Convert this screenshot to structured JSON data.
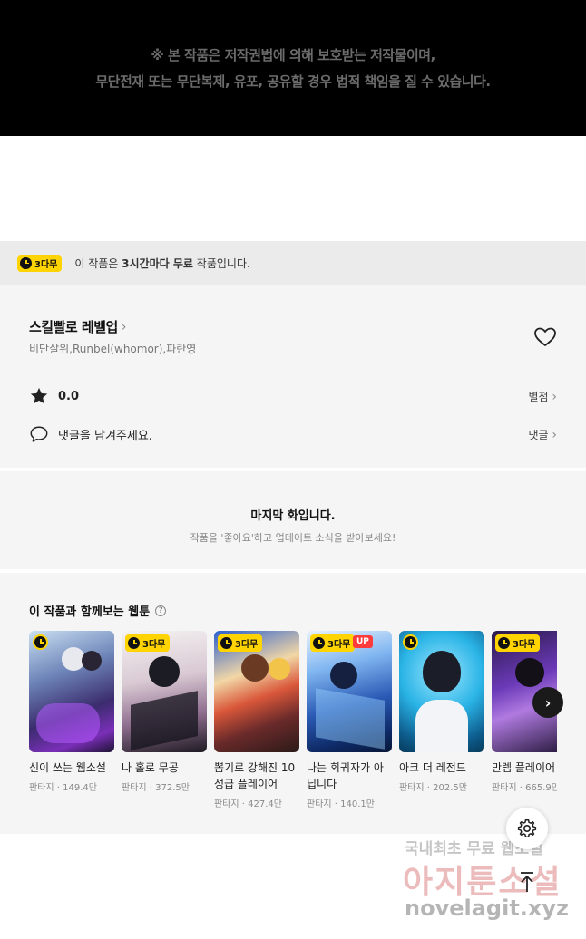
{
  "copyright": {
    "line1": "※ 본 작품은 저작권법에 의해 보호받는 저작물이며,",
    "line2": "무단전재 또는 무단복제, 유포, 공유할 경우 법적 책임을 질 수 있습니다."
  },
  "notice": {
    "badge": "3다무",
    "prefix": "이 작품은",
    "bold": "3시간마다 무료",
    "suffix": "작품입니다."
  },
  "info": {
    "title": "스킬빨로 레벨업",
    "authors": "비단살위,Runbel(whomor),파란영",
    "rating_value": "0.0",
    "rating_link": "별점",
    "comment_prompt": "댓글을 남겨주세요.",
    "comment_link": "댓글"
  },
  "last": {
    "heading": "마지막 화입니다.",
    "sub": "작품을 '좋아요'하고 업데이트 소식을 받아보세요!"
  },
  "recommend": {
    "title": "이 작품과 함께보는 웹툰",
    "help_mark": "?",
    "cards": [
      {
        "title": "신이 쓰는 웹소설",
        "meta": "판타지 · 149.4만",
        "badge": "",
        "up": ""
      },
      {
        "title": "나 홀로 무공",
        "meta": "판타지 · 372.5만",
        "badge": "3다무",
        "up": ""
      },
      {
        "title": "뽑기로 강해진 10성급 플레이어",
        "meta": "판타지 · 427.4만",
        "badge": "3다무",
        "up": ""
      },
      {
        "title": "나는 회귀자가 아닙니다",
        "meta": "판타지 · 140.1만",
        "badge": "3다무",
        "up": "UP"
      },
      {
        "title": "아크 더 레전드",
        "meta": "판타지 · 202.5만",
        "badge": "",
        "up": ""
      },
      {
        "title": "만렙 플레이어",
        "meta": "판타지 · 665.9만",
        "badge": "3다무",
        "up": ""
      }
    ]
  },
  "watermark": {
    "line1": "국내최초 무료 웹소설",
    "line2": "아지툰소설",
    "line3": "novelagit.xyz"
  },
  "colors": {
    "badge_yellow": "#ffd400",
    "up_red": "#ff3b3b"
  }
}
